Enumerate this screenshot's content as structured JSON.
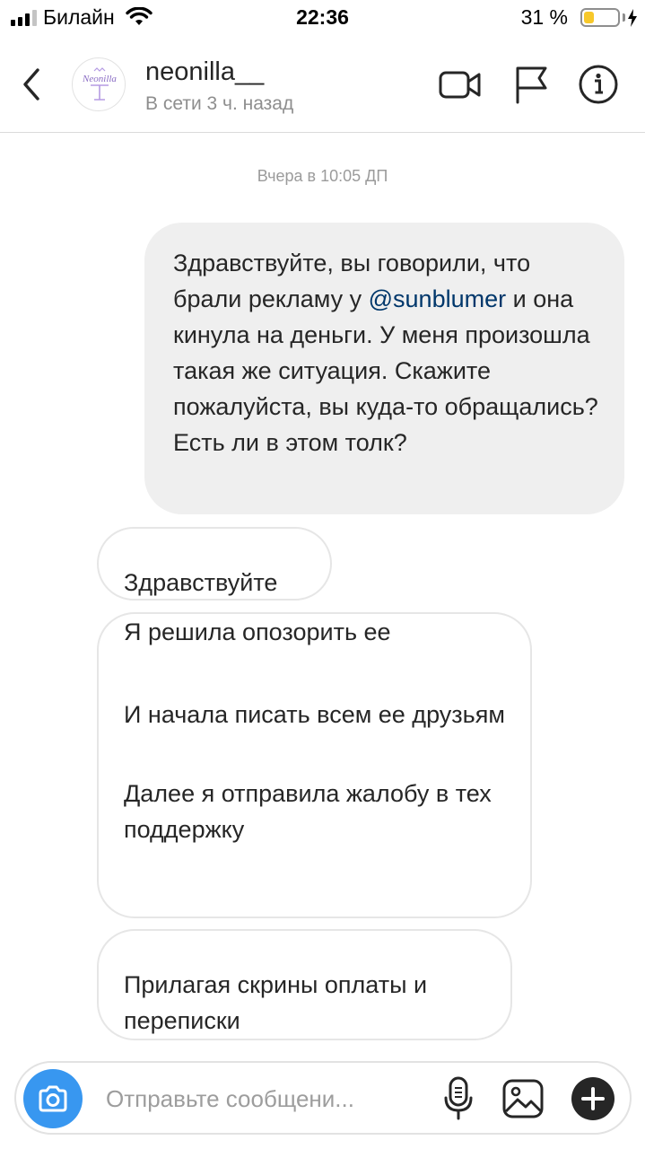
{
  "status_bar": {
    "carrier": "Билайн",
    "time": "22:36",
    "battery_percent": "31 %",
    "battery_level": 0.31,
    "battery_color": "#f7c82a",
    "signal_bars_filled": 3,
    "icons": [
      "signal-icon",
      "wifi-icon",
      "battery-icon",
      "charging-bolt-icon"
    ]
  },
  "header": {
    "username": "neonilla__",
    "status": "В сети 3 ч. назад",
    "avatar_logo_text": "Neonilla",
    "icons": [
      "back-chevron-icon",
      "video-call-icon",
      "flag-icon",
      "info-icon"
    ]
  },
  "chat": {
    "timestamp": "Вчера в 10:05 ДП",
    "outgoing": {
      "text_before": "Здравствуйте, вы говорили, что брали рекламу у ",
      "mention": "@sunblumer",
      "text_after": " и она кинула на деньги. У меня произошла такая же ситуация. Скажите пожалуйста, вы куда-то обращались? Есть ли в этом толк?"
    },
    "incoming": [
      {
        "lines": [
          "Здравствуйте"
        ]
      },
      {
        "lines": [
          "Я решила опозорить ее",
          "",
          "И начала писать всем ее друзьям",
          "",
          "Далее я отправила жалобу в тех поддержку"
        ]
      },
      {
        "lines": [
          "Прилагая скрины оплаты и переписки"
        ]
      }
    ]
  },
  "composer": {
    "placeholder": "Отправьте сообщени...",
    "accent_color": "#3897f0",
    "icons": [
      "camera-icon",
      "microphone-icon",
      "gallery-icon",
      "plus-icon"
    ]
  }
}
